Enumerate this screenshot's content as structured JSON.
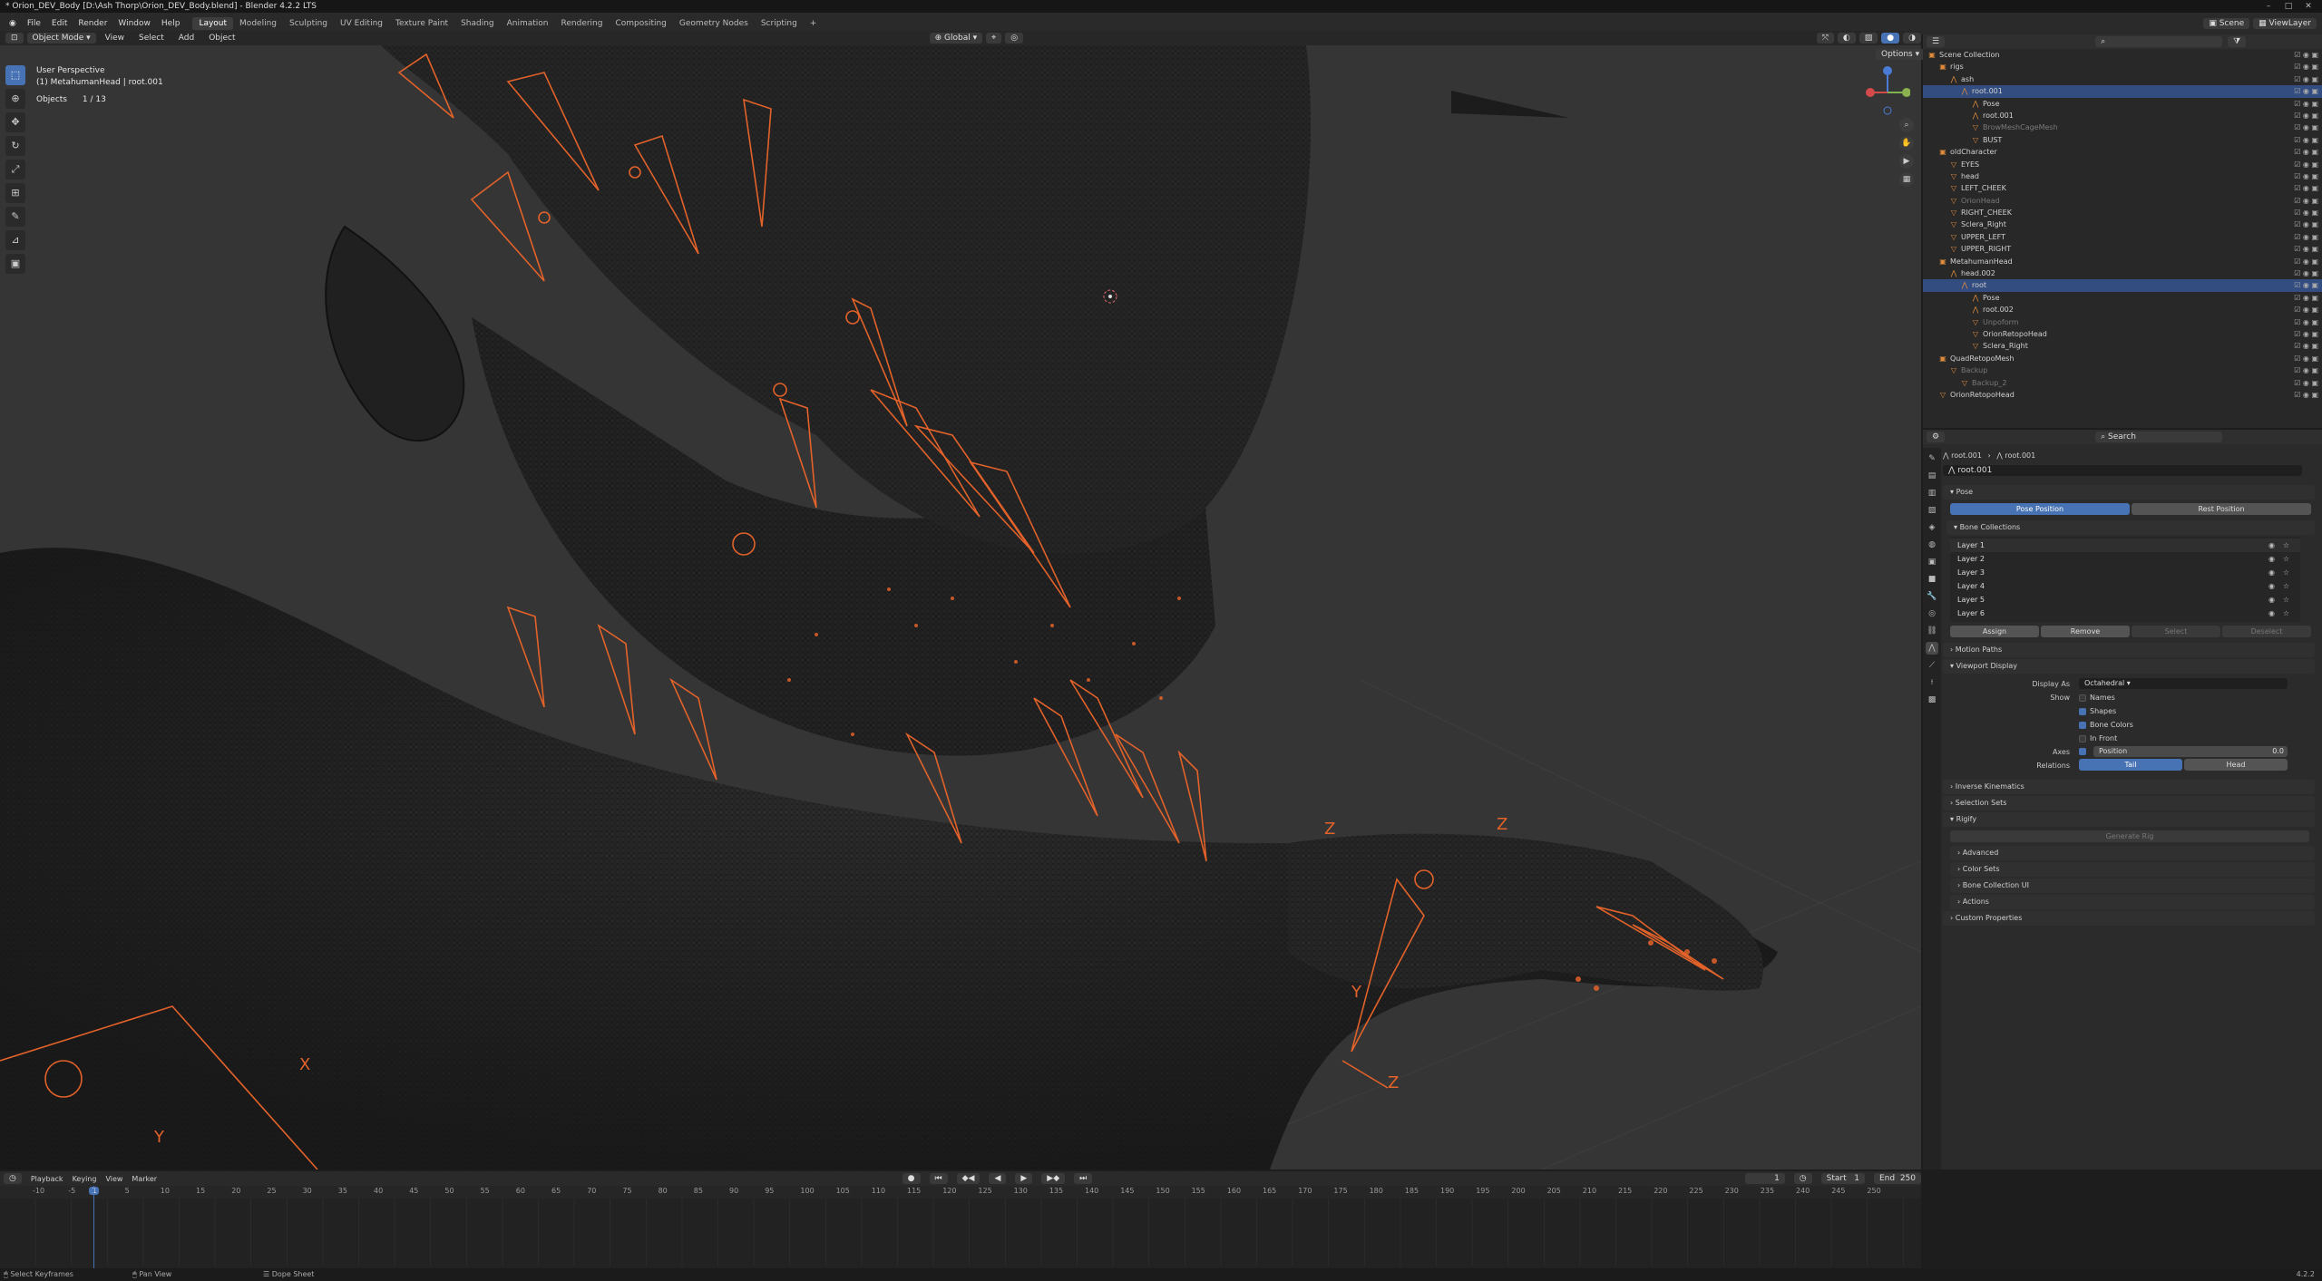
{
  "title": "* Orion_DEV_Body [D:\\Ash Thorp\\Orion_DEV_Body.blend] - Blender 4.2.2 LTS",
  "menu": [
    "File",
    "Edit",
    "Render",
    "Window",
    "Help"
  ],
  "workspaces": [
    "Layout",
    "Modeling",
    "Sculpting",
    "UV Editing",
    "Texture Paint",
    "Shading",
    "Animation",
    "Rendering",
    "Compositing",
    "Geometry Nodes",
    "Scripting"
  ],
  "scene": "Scene",
  "viewlayer": "ViewLayer",
  "viewport": {
    "mode": "Object Mode",
    "menus": [
      "View",
      "Select",
      "Add",
      "Object"
    ],
    "transform": "Global",
    "options": "Options",
    "overlay_line1": "User Perspective",
    "overlay_line2": "(1) MetahumanHead | root.001",
    "objects_label": "Objects",
    "objects_count": "1 / 13"
  },
  "outliner": {
    "search_placeholder": "",
    "rows": [
      {
        "name": "Scene Collection",
        "indent": 0,
        "icon": "▣",
        "sel": false,
        "dim": false
      },
      {
        "name": "rigs",
        "indent": 1,
        "icon": "▣",
        "sel": false,
        "dim": false
      },
      {
        "name": "ash",
        "indent": 2,
        "icon": "⋀",
        "sel": false,
        "dim": false
      },
      {
        "name": "root.001",
        "indent": 3,
        "icon": "⋀",
        "sel": true,
        "dim": false
      },
      {
        "name": "Pose",
        "indent": 4,
        "icon": "⋀",
        "sel": false,
        "dim": false
      },
      {
        "name": "root.001",
        "indent": 4,
        "icon": "⋀",
        "sel": false,
        "dim": false
      },
      {
        "name": "BrowMeshCageMesh",
        "indent": 4,
        "icon": "▽",
        "sel": false,
        "dim": true
      },
      {
        "name": "BUST",
        "indent": 4,
        "icon": "▽",
        "sel": false,
        "dim": false
      },
      {
        "name": "oldCharacter",
        "indent": 1,
        "icon": "▣",
        "sel": false,
        "dim": false
      },
      {
        "name": "EYES",
        "indent": 2,
        "icon": "▽",
        "sel": false,
        "dim": false
      },
      {
        "name": "head",
        "indent": 2,
        "icon": "▽",
        "sel": false,
        "dim": false
      },
      {
        "name": "LEFT_CHEEK",
        "indent": 2,
        "icon": "▽",
        "sel": false,
        "dim": false
      },
      {
        "name": "OrionHead",
        "indent": 2,
        "icon": "▽",
        "sel": false,
        "dim": true
      },
      {
        "name": "RIGHT_CHEEK",
        "indent": 2,
        "icon": "▽",
        "sel": false,
        "dim": false
      },
      {
        "name": "Sclera_Right",
        "indent": 2,
        "icon": "▽",
        "sel": false,
        "dim": false
      },
      {
        "name": "UPPER_LEFT",
        "indent": 2,
        "icon": "▽",
        "sel": false,
        "dim": false
      },
      {
        "name": "UPPER_RIGHT",
        "indent": 2,
        "icon": "▽",
        "sel": false,
        "dim": false
      },
      {
        "name": "MetahumanHead",
        "indent": 1,
        "icon": "▣",
        "sel": false,
        "dim": false
      },
      {
        "name": "head.002",
        "indent": 2,
        "icon": "⋀",
        "sel": false,
        "dim": false
      },
      {
        "name": "root",
        "indent": 3,
        "icon": "⋀",
        "sel": true,
        "dim": false
      },
      {
        "name": "Pose",
        "indent": 4,
        "icon": "⋀",
        "sel": false,
        "dim": false
      },
      {
        "name": "root.002",
        "indent": 4,
        "icon": "⋀",
        "sel": false,
        "dim": false
      },
      {
        "name": "Unpoform",
        "indent": 4,
        "icon": "▽",
        "sel": false,
        "dim": true
      },
      {
        "name": "OrionRetopoHead",
        "indent": 4,
        "icon": "▽",
        "sel": false,
        "dim": false
      },
      {
        "name": "Sclera_Right",
        "indent": 4,
        "icon": "▽",
        "sel": false,
        "dim": false
      },
      {
        "name": "QuadRetopoMesh",
        "indent": 1,
        "icon": "▣",
        "sel": false,
        "dim": false
      },
      {
        "name": "Backup",
        "indent": 2,
        "icon": "▽",
        "sel": false,
        "dim": true
      },
      {
        "name": "Backup_2",
        "indent": 3,
        "icon": "▽",
        "sel": false,
        "dim": true
      },
      {
        "name": "OrionRetopoHead",
        "indent": 1,
        "icon": "▽",
        "sel": false,
        "dim": false
      }
    ]
  },
  "properties": {
    "search_placeholder": "Search",
    "breadcrumb": [
      "root.001",
      "root.001"
    ],
    "datablock": "root.001",
    "pose_section": "Pose",
    "pose_position": "Pose Position",
    "rest_position": "Rest Position",
    "bone_collections": "Bone Collections",
    "layers": [
      "Layer 1",
      "Layer 2",
      "Layer 3",
      "Layer 4",
      "Layer 5",
      "Layer 6"
    ],
    "assign": "Assign",
    "remove": "Remove",
    "select": "Select",
    "deselect": "Deselect",
    "motion_paths": "Motion Paths",
    "viewport_display": "Viewport Display",
    "display_as_label": "Display As",
    "display_as": "Octahedral",
    "show_label": "Show",
    "show_names": "Names",
    "show_shapes": "Shapes",
    "show_bone_colors": "Bone Colors",
    "show_in_front": "In Front",
    "axes_label": "Axes",
    "axes_value": "Position",
    "axes_num": "0.0",
    "relations_label": "Relations",
    "tail": "Tail",
    "head": "Head",
    "inverse_kinematics": "Inverse Kinematics",
    "selection_sets": "Selection Sets",
    "rigify": "Rigify",
    "generate_rig": "Generate Rig",
    "advanced": "Advanced",
    "color_sets": "Color Sets",
    "bone_collection_ui": "Bone Collection UI",
    "actions": "Actions",
    "custom_properties": "Custom Properties"
  },
  "timeline": {
    "menus": [
      "Playback",
      "Keying",
      "View",
      "Marker"
    ],
    "current_frame": "1",
    "start_label": "Start",
    "start": "1",
    "end_label": "End",
    "end": "250",
    "ticks": [
      "-10",
      "-5",
      "1",
      "5",
      "10",
      "15",
      "20",
      "25",
      "30",
      "35",
      "40",
      "45",
      "50",
      "55",
      "60",
      "65",
      "70",
      "75",
      "80",
      "85",
      "90",
      "95",
      "100",
      "105",
      "110",
      "115",
      "120",
      "125",
      "130",
      "135",
      "140",
      "145",
      "150",
      "155",
      "160",
      "165",
      "170",
      "175",
      "180",
      "185",
      "190",
      "195",
      "200",
      "205",
      "210",
      "215",
      "220",
      "225",
      "230",
      "235",
      "240",
      "245",
      "250"
    ]
  },
  "status": {
    "left": "Select Keyframes",
    "mid": "Pan View",
    "right": "Dope Sheet",
    "version": "4.2.2"
  },
  "colors": {
    "accent": "#4772b3",
    "bone": "#e2622a",
    "bone_light": "#f08a3c"
  }
}
